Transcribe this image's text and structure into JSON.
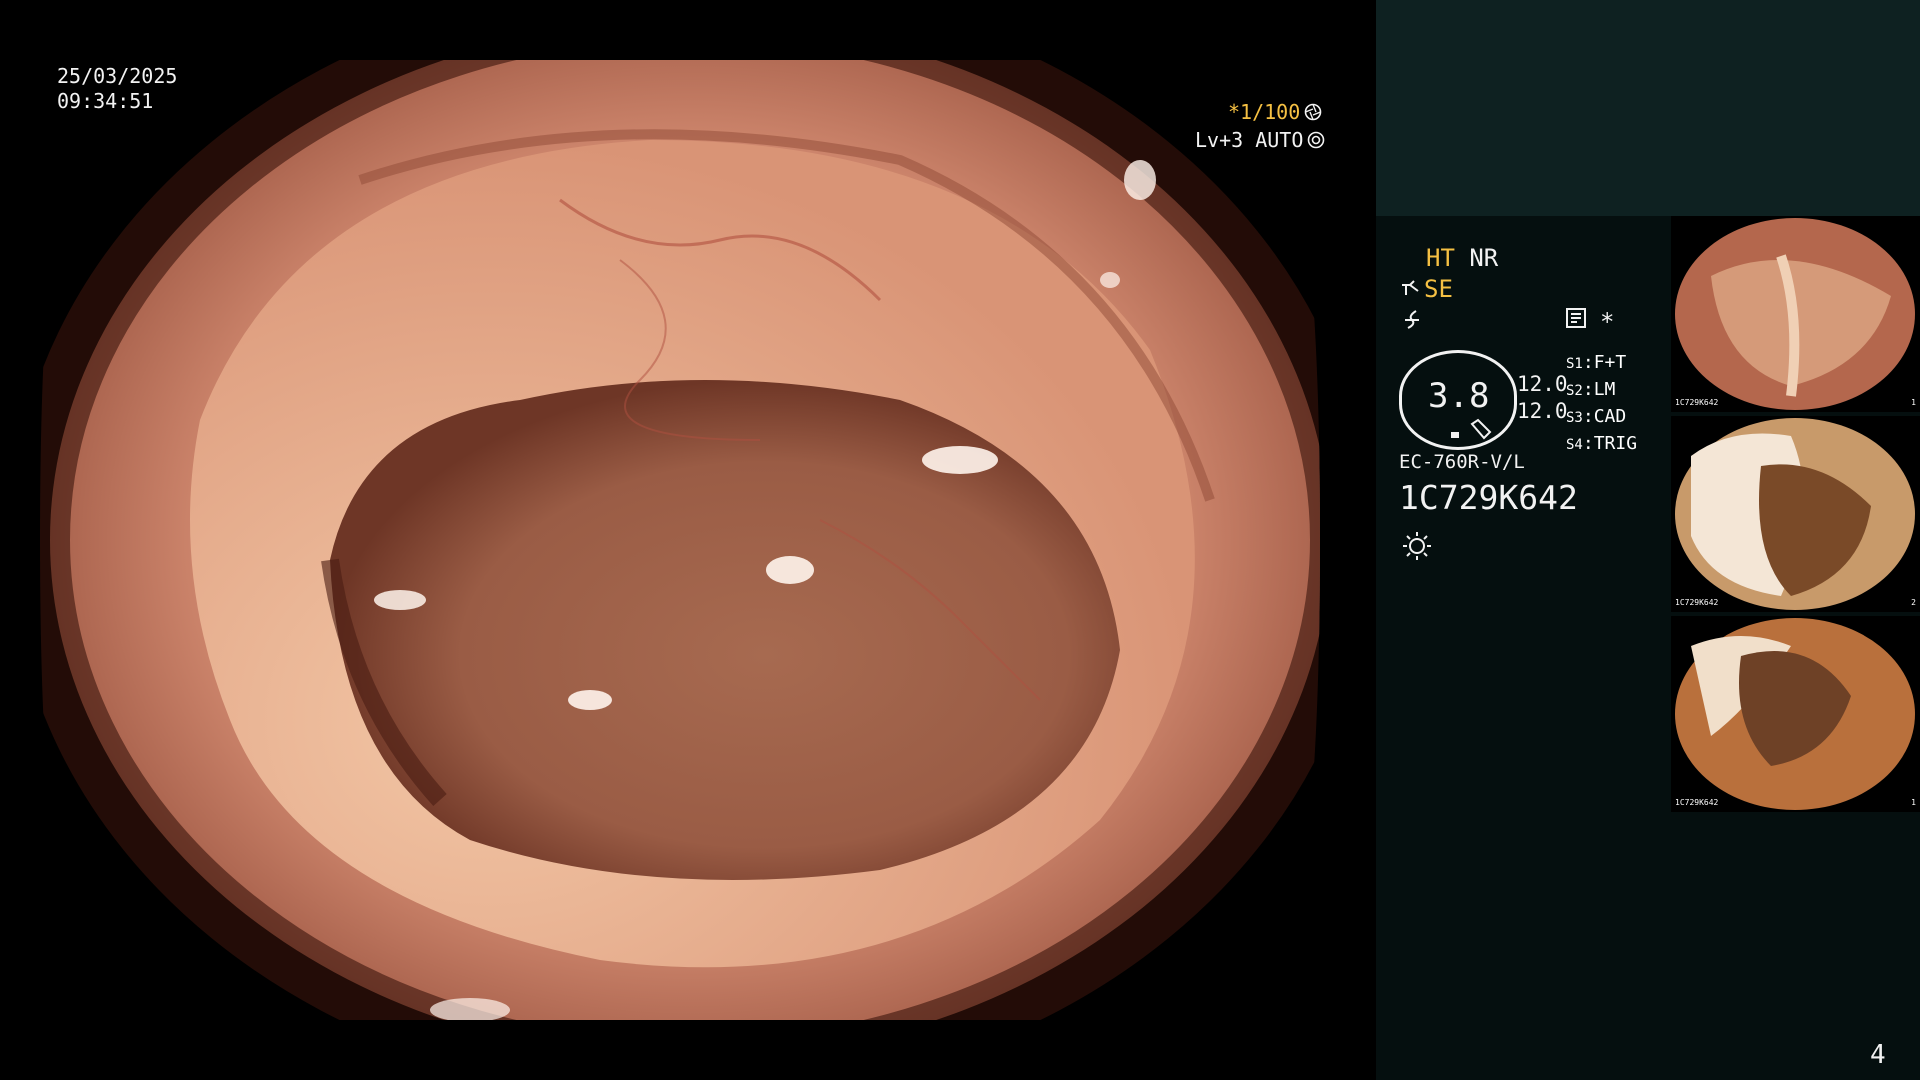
{
  "osd": {
    "date": "25/03/2025",
    "time": "09:34:51",
    "shutter": "*1/100",
    "level": "Lv+3 AUTO"
  },
  "panel": {
    "ht": "HT",
    "nr": "NR",
    "se": "SE",
    "ring_value": "3.8",
    "side_values": [
      "12.0",
      "12.0"
    ],
    "switches": [
      {
        "key": "S1",
        "value": "F+T"
      },
      {
        "key": "S2",
        "value": "LM"
      },
      {
        "key": "S3",
        "value": "CAD"
      },
      {
        "key": "S4",
        "value": "TRIG"
      }
    ],
    "scope_model": "EC-760R-V/L",
    "serial": "1C729K642",
    "page_number": "4",
    "asterisk": "*"
  },
  "thumbnails": [
    {
      "label": "1C729K642",
      "index": "1"
    },
    {
      "label": "1C729K642",
      "index": "2"
    },
    {
      "label": "1C729K642",
      "index": "1"
    }
  ],
  "colors": {
    "accent_yellow": "#f5c043",
    "panel_bg": "#050f0f",
    "panel_top_bg": "#0e2121",
    "tissue": "#c9826a"
  },
  "icons": [
    "aperture-icon",
    "auto-light-icon",
    "scissors-icon",
    "squiggle-icon",
    "memo-icon",
    "sun-icon"
  ]
}
